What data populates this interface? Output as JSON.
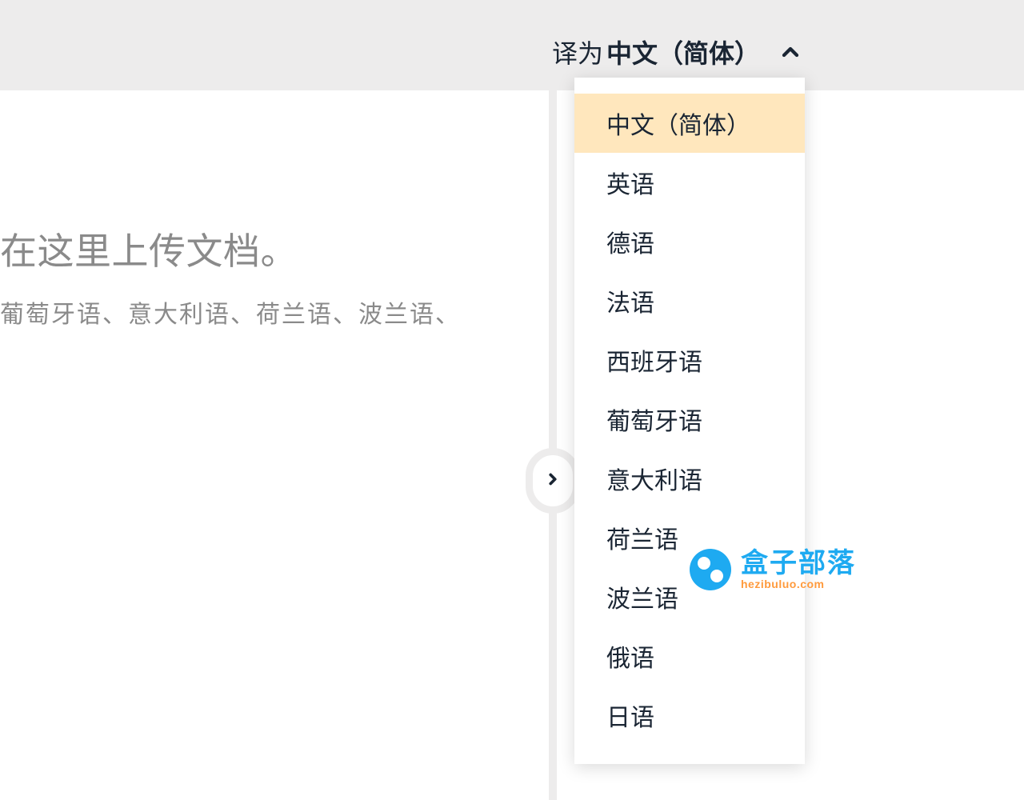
{
  "header": {
    "translate_prefix": "译为",
    "selected_language": "中文（简体）"
  },
  "main": {
    "upload_heading": "在这里上传文档。",
    "language_list_text": "葡萄牙语、意大利语、荷兰语、波兰语、"
  },
  "dropdown": {
    "items": [
      {
        "label": "中文（简体）",
        "selected": true
      },
      {
        "label": "英语",
        "selected": false
      },
      {
        "label": "德语",
        "selected": false
      },
      {
        "label": "法语",
        "selected": false
      },
      {
        "label": "西班牙语",
        "selected": false
      },
      {
        "label": "葡萄牙语",
        "selected": false
      },
      {
        "label": "意大利语",
        "selected": false
      },
      {
        "label": "荷兰语",
        "selected": false
      },
      {
        "label": "波兰语",
        "selected": false
      },
      {
        "label": "俄语",
        "selected": false
      },
      {
        "label": "日语",
        "selected": false
      }
    ]
  },
  "watermark": {
    "chinese": "盒子部落",
    "pinyin": "hezibuluo.com"
  }
}
